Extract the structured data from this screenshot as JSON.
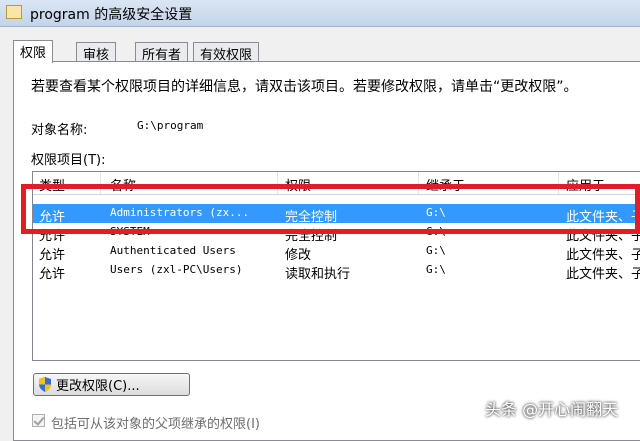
{
  "window": {
    "title": "program 的高级安全设置"
  },
  "tabs": [
    {
      "label": "权限",
      "active": true
    },
    {
      "label": "审核",
      "active": false
    },
    {
      "label": "所有者",
      "active": false
    },
    {
      "label": "有效权限",
      "active": false
    }
  ],
  "panel": {
    "intro": "若要查看某个权限项目的详细信息，请双击该项目。若要修改权限，请单击“更改权限”。",
    "object_label": "对象名称:",
    "object_value": "G:\\program",
    "list_label": "权限项目(T):"
  },
  "permissions": {
    "columns": [
      "类型",
      "名称",
      "权限",
      "继承于",
      "应用于"
    ],
    "rows": [
      {
        "type": "允许",
        "name": "Administrators (zx...",
        "permission": "完全控制",
        "inherited": "G:\\",
        "applies": "此文件夹、子...",
        "selected": true
      },
      {
        "type": "允许",
        "name": "SYSTEM",
        "permission": "完全控制",
        "inherited": "G:\\",
        "applies": "此文件夹、子...",
        "selected": false
      },
      {
        "type": "允许",
        "name": "Authenticated Users",
        "permission": "修改",
        "inherited": "G:\\",
        "applies": "此文件夹、子...",
        "selected": false
      },
      {
        "type": "允许",
        "name": "Users (zxl-PC\\Users)",
        "permission": "读取和执行",
        "inherited": "G:\\",
        "applies": "此文件夹、子...",
        "selected": false
      }
    ]
  },
  "change_button": {
    "label": "更改权限(C)...",
    "icon": "uac-shield-icon"
  },
  "inherit_checkbox": {
    "label": "包括可从该对象的父项继承的权限(I)",
    "checked": true,
    "disabled": true
  },
  "watermark": "头条 @开心闹翻天",
  "colors": {
    "selection": "#3399ff",
    "highlight_box": "#e21c2a"
  }
}
